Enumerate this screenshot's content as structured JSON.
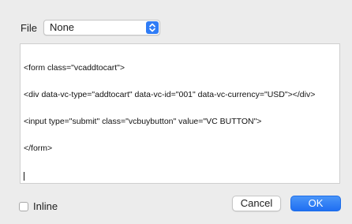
{
  "file": {
    "label": "File",
    "selected": "None"
  },
  "editor": {
    "lines": [
      "<form class=\"vcaddtocart\">",
      "<div data-vc-type=\"addtocart\" data-vc-id=\"001\" data-vc-currency=\"USD\"></div>",
      "<input type=\"submit\" class=\"vcbuybutton\" value=\"VC BUTTON\">",
      "</form>"
    ]
  },
  "inline": {
    "label": "Inline",
    "checked": false
  },
  "buttons": {
    "cancel": "Cancel",
    "ok": "OK"
  },
  "colors": {
    "accent": "#2f7cf6",
    "window_bg": "#ececec"
  },
  "icons": {
    "select_arrow": "chevron-up-down-icon"
  }
}
